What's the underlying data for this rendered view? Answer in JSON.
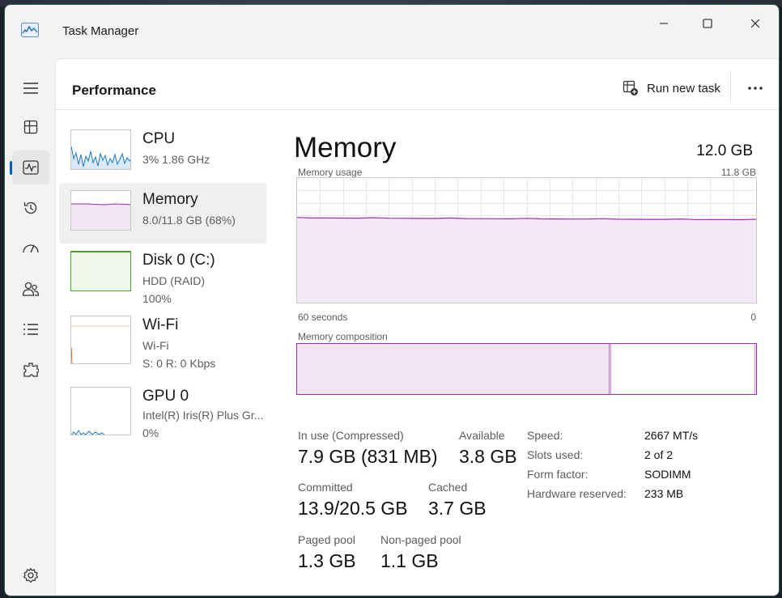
{
  "app": {
    "title": "Task Manager"
  },
  "page": {
    "title": "Performance",
    "run_new_task": "Run new task"
  },
  "rail": [
    {
      "icon": "hamburger-menu-icon"
    },
    {
      "icon": "processes-icon"
    },
    {
      "icon": "performance-icon",
      "active": true
    },
    {
      "icon": "app-history-icon"
    },
    {
      "icon": "startup-apps-icon"
    },
    {
      "icon": "users-icon"
    },
    {
      "icon": "details-icon"
    },
    {
      "icon": "services-icon"
    },
    {
      "icon": "settings-icon"
    }
  ],
  "devices": [
    {
      "name": "CPU",
      "sub": "3%  1.86 GHz",
      "sub2": ""
    },
    {
      "name": "Memory",
      "sub": "8.0/11.8 GB (68%)",
      "sub2": ""
    },
    {
      "name": "Disk 0 (C:)",
      "sub": "HDD (RAID)",
      "sub2": "100%"
    },
    {
      "name": "Wi-Fi",
      "sub": "Wi-Fi",
      "sub2": "S: 0  R: 0 Kbps"
    },
    {
      "name": "GPU 0",
      "sub": "Intel(R) Iris(R) Plus Gr...",
      "sub2": "0%"
    }
  ],
  "memory": {
    "title": "Memory",
    "total": "12.0 GB",
    "usage_label": "Memory usage",
    "usage_max": "11.8 GB",
    "time_left": "60 seconds",
    "time_right": "0",
    "composition_label": "Memory composition",
    "in_use_fraction": 0.68,
    "stats": {
      "in_use_label": "In use (Compressed)",
      "in_use_value": "7.9 GB (831 MB)",
      "available_label": "Available",
      "available_value": "3.8 GB",
      "committed_label": "Committed",
      "committed_value": "13.9/20.5 GB",
      "cached_label": "Cached",
      "cached_value": "3.7 GB",
      "paged_label": "Paged pool",
      "paged_value": "1.3 GB",
      "nonpaged_label": "Non-paged pool",
      "nonpaged_value": "1.1 GB"
    },
    "props": {
      "speed_label": "Speed:",
      "speed_value": "2667 MT/s",
      "slots_label": "Slots used:",
      "slots_value": "2 of 2",
      "form_label": "Form factor:",
      "form_value": "SODIMM",
      "reserved_label": "Hardware reserved:",
      "reserved_value": "233 MB"
    }
  },
  "colors": {
    "memory_line": "#9a2fb0",
    "memory_fill": "#f1e5f4",
    "cpu_line": "#1b79c7",
    "disk_line": "#4ca22b",
    "wifi_line": "#b8722b",
    "accent": "#005fb8"
  }
}
